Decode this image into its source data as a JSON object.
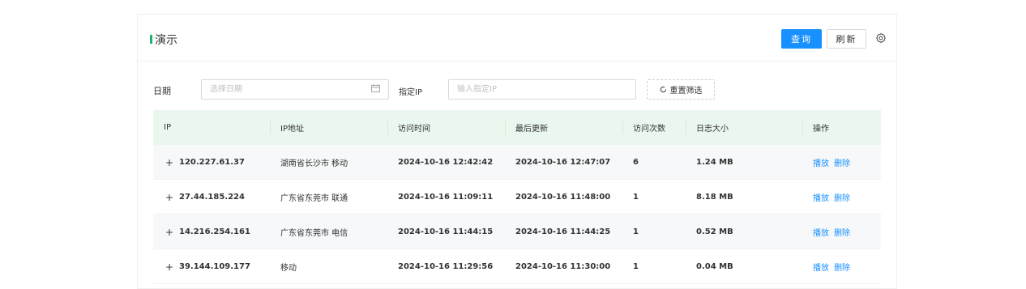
{
  "header": {
    "title": "演示",
    "query_label": "查询",
    "refresh_label": "刷新",
    "accent_color": "#20b26c",
    "primary_color": "#1890ff"
  },
  "filters": {
    "date_label": "日期",
    "date_placeholder": "选择日期",
    "ip_label": "指定IP",
    "ip_placeholder": "输入指定IP",
    "reset_label": "重置筛选"
  },
  "table": {
    "columns": [
      "IP",
      "IP地址",
      "访问时间",
      "最后更新",
      "访问次数",
      "日志大小",
      "操作"
    ],
    "rows": [
      {
        "ip": "120.227.61.37",
        "location": "湖南省长沙市 移动",
        "visit_time": "2024-10-16 12:42:42",
        "last_update": "2024-10-16 12:47:07",
        "count": "6",
        "size": "1.24 MB"
      },
      {
        "ip": "27.44.185.224",
        "location": "广东省东莞市 联通",
        "visit_time": "2024-10-16 11:09:11",
        "last_update": "2024-10-16 11:48:00",
        "count": "1",
        "size": "8.18 MB"
      },
      {
        "ip": "14.216.254.161",
        "location": "广东省东莞市 电信",
        "visit_time": "2024-10-16 11:44:15",
        "last_update": "2024-10-16 11:44:25",
        "count": "1",
        "size": "0.52 MB"
      },
      {
        "ip": "39.144.109.177",
        "location": "移动",
        "visit_time": "2024-10-16 11:29:56",
        "last_update": "2024-10-16 11:30:00",
        "count": "1",
        "size": "0.04 MB"
      }
    ],
    "actions": {
      "play": "播放",
      "delete": "删除"
    },
    "expand_symbol": "+"
  }
}
